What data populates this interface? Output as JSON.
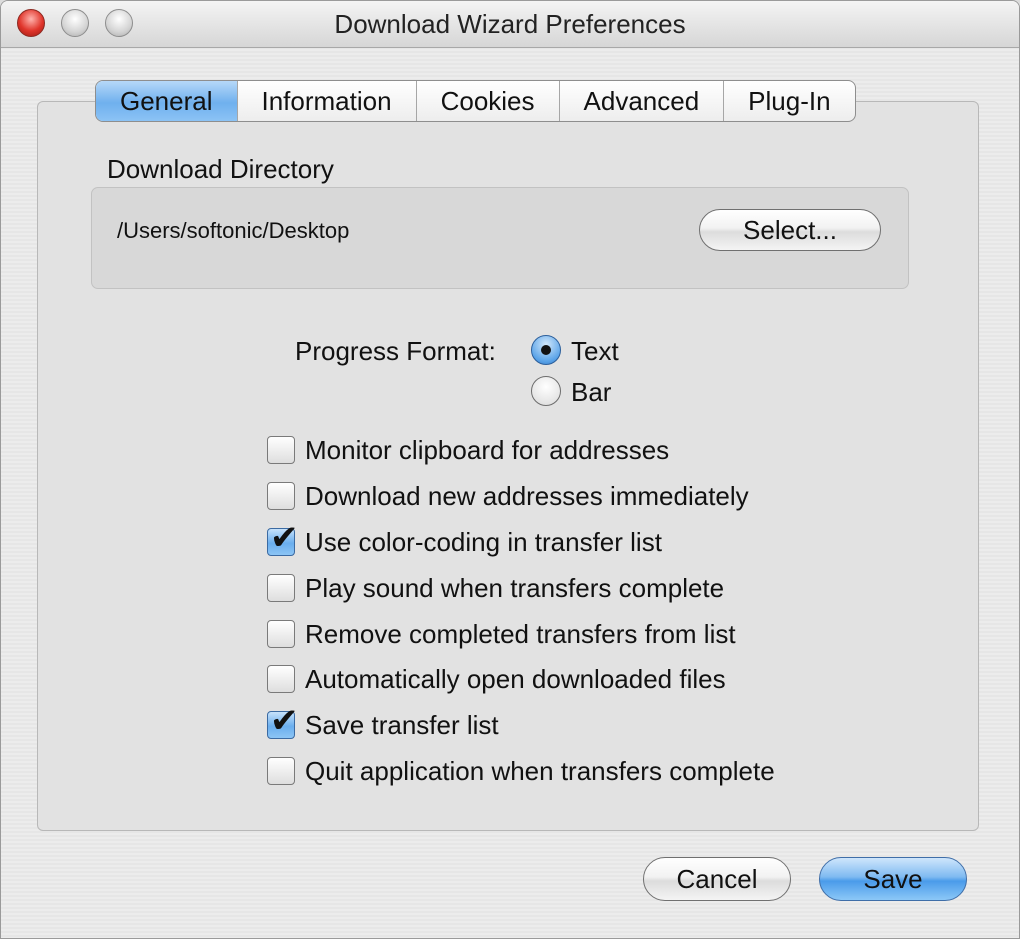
{
  "window": {
    "title": "Download Wizard Preferences"
  },
  "tabs": [
    {
      "label": "General",
      "active": true
    },
    {
      "label": "Information",
      "active": false
    },
    {
      "label": "Cookies",
      "active": false
    },
    {
      "label": "Advanced",
      "active": false
    },
    {
      "label": "Plug-In",
      "active": false
    }
  ],
  "download_directory": {
    "label": "Download Directory",
    "path": "/Users/softonic/Desktop",
    "select_button": "Select..."
  },
  "progress_format": {
    "label": "Progress Format:",
    "options": [
      {
        "label": "Text",
        "selected": true
      },
      {
        "label": "Bar",
        "selected": false
      }
    ]
  },
  "options": [
    {
      "label": "Monitor clipboard for addresses",
      "checked": false
    },
    {
      "label": "Download new addresses immediately",
      "checked": false
    },
    {
      "label": "Use color-coding in transfer list",
      "checked": true
    },
    {
      "label": "Play sound when transfers complete",
      "checked": false
    },
    {
      "label": "Remove completed transfers from list",
      "checked": false
    },
    {
      "label": "Automatically open downloaded files",
      "checked": false
    },
    {
      "label": "Save transfer list",
      "checked": true
    },
    {
      "label": "Quit application when transfers complete",
      "checked": false
    }
  ],
  "buttons": {
    "cancel": "Cancel",
    "save": "Save"
  },
  "icons": {
    "check": "✔"
  },
  "colors": {
    "accent": "#5aa3e8",
    "close_button": "#e0352b"
  }
}
